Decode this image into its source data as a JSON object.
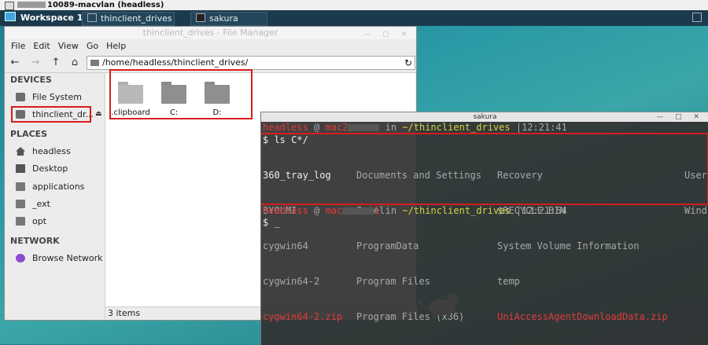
{
  "viewer": {
    "title": "10089-macvlan (headless)"
  },
  "panel": {
    "workspace": "Workspace 1",
    "tasks": [
      "thinclient_drives -...",
      "sakura"
    ]
  },
  "file_manager": {
    "title": "thinclient_drives - File Manager",
    "menu": [
      "File",
      "Edit",
      "View",
      "Go",
      "Help"
    ],
    "address": "/home/headless/thinclient_drives/",
    "sidebar": {
      "devices_heading": "DEVICES",
      "devices": [
        "File System",
        "thinclient_dr..."
      ],
      "places_heading": "PLACES",
      "places": [
        "headless",
        "Desktop",
        "applications",
        "_ext",
        "opt"
      ],
      "network_heading": "NETWORK",
      "network": [
        "Browse Network"
      ]
    },
    "folders": [
      ".clipboard",
      "C:",
      "D:"
    ],
    "status": "3 items"
  },
  "terminal": {
    "title": "sakura",
    "prompt1": {
      "user": "headless",
      "at": "@",
      "host": "mac2",
      "in": "in",
      "dir": "~/thinclient_drives",
      "sep": "|",
      "time": "12:21:41"
    },
    "command": "$ ls C*/",
    "listing": {
      "col1": [
        "360_tray_log",
        "BYOLMI",
        "cygwin64",
        "cygwin64-2",
        "cygwin64-2.zip"
      ],
      "col2": [
        "Documents and Settings",
        "Intel",
        "ProgramData",
        "Program Files",
        "Program Files (x86)"
      ],
      "col3": [
        "Recovery",
        "$RECYCLE.BIN",
        "System Volume Information",
        "temp",
        "UniAccessAgentDownloadData.zip"
      ],
      "col4": [
        "User",
        "Wind"
      ]
    },
    "prompt2": {
      "user": "headless",
      "at": "@",
      "host": "mac",
      "hostend": "1",
      "in": "in",
      "dir": "~/thinclient_drives",
      "sep": "|",
      "time": "12:21:54"
    },
    "cursor_line": "$ _"
  }
}
